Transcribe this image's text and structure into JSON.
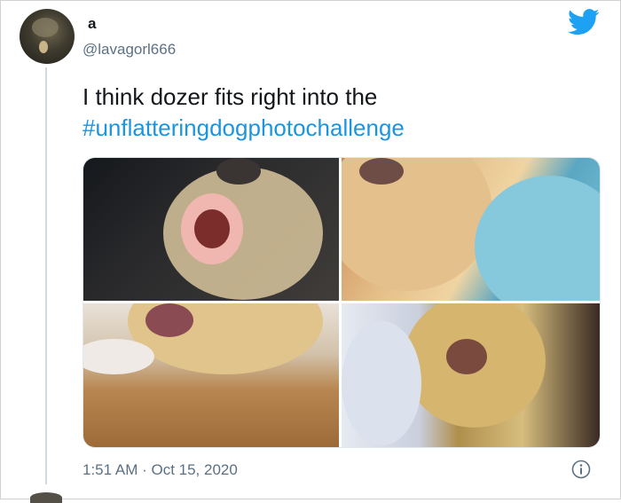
{
  "tweet": {
    "display_name": "a",
    "username": "@lavagorl666",
    "text": "I think dozer fits right into the",
    "hashtag": "#unflatteringdogphotochallenge",
    "timestamp": "1:51 AM · Oct 15, 2020",
    "photos": [
      {
        "icon": "dog-photo-teeth"
      },
      {
        "icon": "dog-photo-towel"
      },
      {
        "icon": "dog-photo-upside-down"
      },
      {
        "icon": "dog-photo-squint"
      }
    ]
  },
  "icons": {
    "brand": "twitter-bird-icon",
    "info": "info-icon"
  },
  "colors": {
    "brand_blue": "#1da1f2",
    "hashtag_blue": "#1b95e0",
    "secondary_text": "#5b7083"
  }
}
